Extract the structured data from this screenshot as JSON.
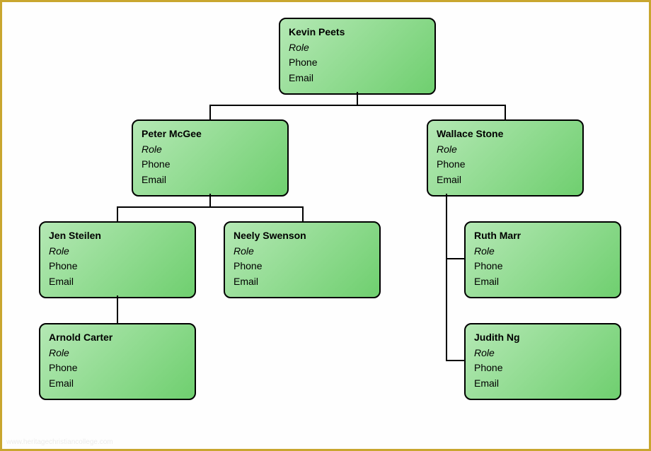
{
  "labels": {
    "role": "Role",
    "phone": "Phone",
    "email": "Email"
  },
  "nodes": {
    "kevin": {
      "name": "Kevin Peets"
    },
    "peter": {
      "name": "Peter McGee"
    },
    "wallace": {
      "name": "Wallace Stone"
    },
    "jen": {
      "name": "Jen Steilen"
    },
    "neely": {
      "name": "Neely Swenson"
    },
    "ruth": {
      "name": "Ruth Marr"
    },
    "arnold": {
      "name": "Arnold Carter"
    },
    "judith": {
      "name": "Judith Ng"
    }
  },
  "watermark": "www.heritagechristiancollege.com"
}
